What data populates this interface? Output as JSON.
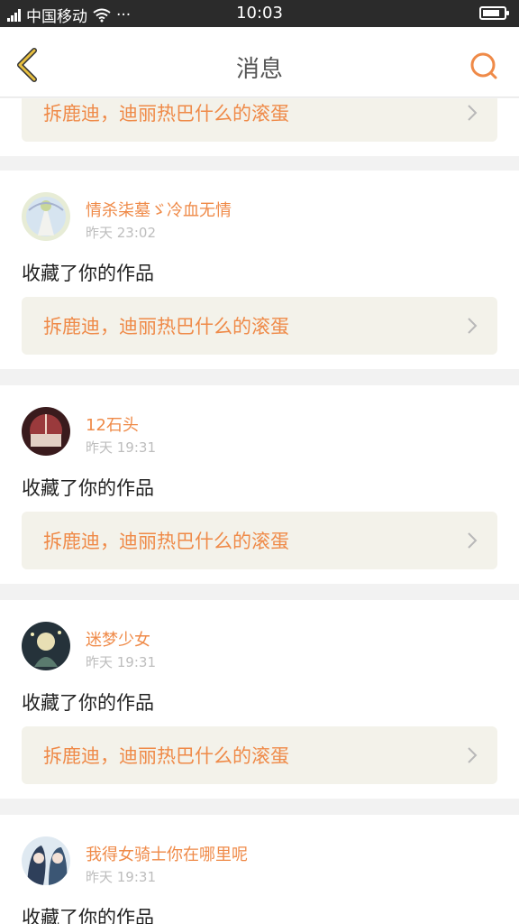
{
  "status_bar": {
    "carrier": "中国移动",
    "more": "···",
    "time": "10:03",
    "battery_level": 0.8
  },
  "header": {
    "title": "消息",
    "back_icon": "chevron-left-icon",
    "search_icon": "search-icon"
  },
  "colors": {
    "accent": "#ef8a48",
    "back_accent": "#e8c040",
    "work_bg": "#f3f2ea"
  },
  "partial_card": {
    "work_title": "拆鹿迪，迪丽热巴什么的滚蛋"
  },
  "notifications": [
    {
      "username": "情杀柒墓ゞ冷血无情",
      "time": "昨天 23:02",
      "message": "收藏了你的作品",
      "work_title": "拆鹿迪，迪丽热巴什么的滚蛋"
    },
    {
      "username": "12石头",
      "time": "昨天 19:31",
      "message": "收藏了你的作品",
      "work_title": "拆鹿迪，迪丽热巴什么的滚蛋"
    },
    {
      "username": "迷梦少女",
      "time": "昨天 19:31",
      "message": "收藏了你的作品",
      "work_title": "拆鹿迪，迪丽热巴什么的滚蛋"
    },
    {
      "username": "我得女骑士你在哪里呢",
      "time": "昨天 19:31",
      "message": "收藏了你的作品"
    }
  ]
}
